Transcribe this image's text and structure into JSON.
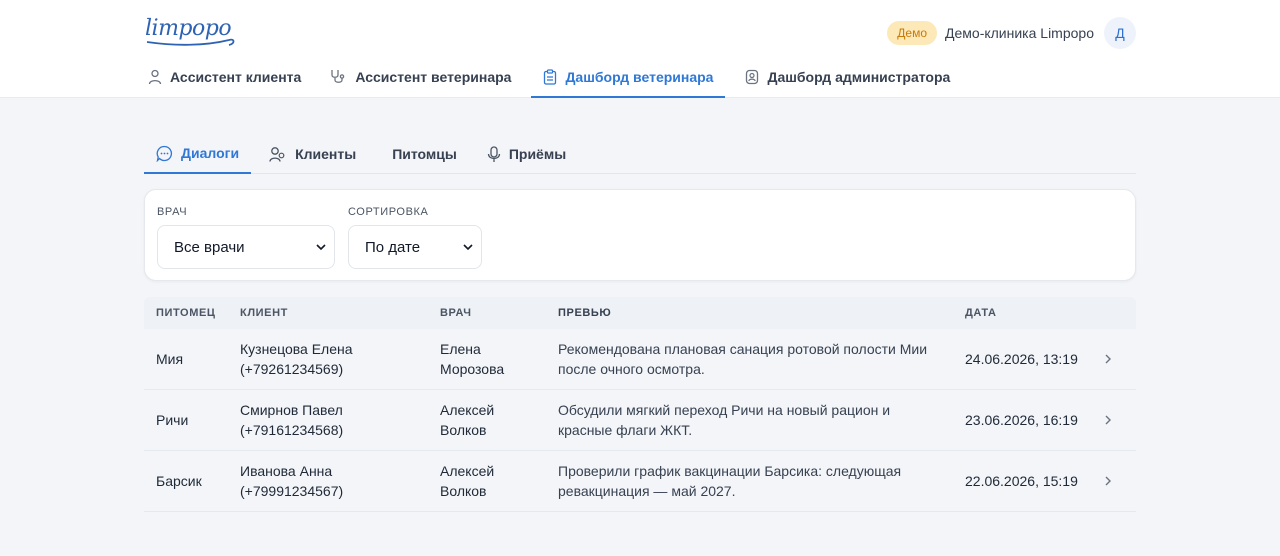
{
  "header": {
    "logo_text": "limpopo",
    "demo_badge": "Демо",
    "clinic_name": "Демо-клиника Limpopo",
    "avatar_initial": "Д",
    "nav": [
      {
        "label": "Ассистент клиента",
        "icon": "person-icon"
      },
      {
        "label": "Ассистент ветеринара",
        "icon": "stethoscope-icon"
      },
      {
        "label": "Дашборд ветеринара",
        "icon": "clipboard-icon",
        "active": true
      },
      {
        "label": "Дашборд администратора",
        "icon": "admin-badge-icon"
      }
    ]
  },
  "tabs": [
    {
      "label": "Диалоги",
      "icon": "chat-icon",
      "active": true
    },
    {
      "label": "Клиенты",
      "icon": "users-icon"
    },
    {
      "label": "Питомцы",
      "icon": ""
    },
    {
      "label": "Приёмы",
      "icon": "microphone-icon"
    }
  ],
  "filters": {
    "doctor_label": "ВРАЧ",
    "doctor_value": "Все врачи",
    "sort_label": "СОРТИРОВКА",
    "sort_value": "По дате"
  },
  "table": {
    "columns": [
      "ПИТОМЕЦ",
      "КЛИЕНТ",
      "ВРАЧ",
      "ПРЕВЬЮ",
      "ДАТА"
    ],
    "rows": [
      {
        "pet": "Мия",
        "client_name": "Кузнецова Елена",
        "client_phone": "(+79261234569)",
        "doctor_first": "Елена",
        "doctor_last": "Морозова",
        "preview_1": "Рекомендована плановая санация ротовой полости Мии",
        "preview_2": "после очного осмотра.",
        "date": "24.06.2026, 13:19"
      },
      {
        "pet": "Ричи",
        "client_name": "Смирнов Павел",
        "client_phone": "(+79161234568)",
        "doctor_first": "Алексей",
        "doctor_last": "Волков",
        "preview_1": "Обсудили мягкий переход Ричи на новый рацион и",
        "preview_2": "красные флаги ЖКТ.",
        "date": "23.06.2026, 16:19"
      },
      {
        "pet": "Барсик",
        "client_name": "Иванова Анна",
        "client_phone": "(+79991234567)",
        "doctor_first": "Алексей",
        "doctor_last": "Волков",
        "preview_1": "Проверили график вакцинации Барсика: следующая",
        "preview_2": "ревакцинация — май 2027.",
        "date": "22.06.2026, 15:19"
      }
    ]
  },
  "colors": {
    "accent": "#2f78d6",
    "badge_bg": "#fde8b8",
    "badge_text": "#c77a08",
    "page_bg": "#f3f5f8"
  }
}
